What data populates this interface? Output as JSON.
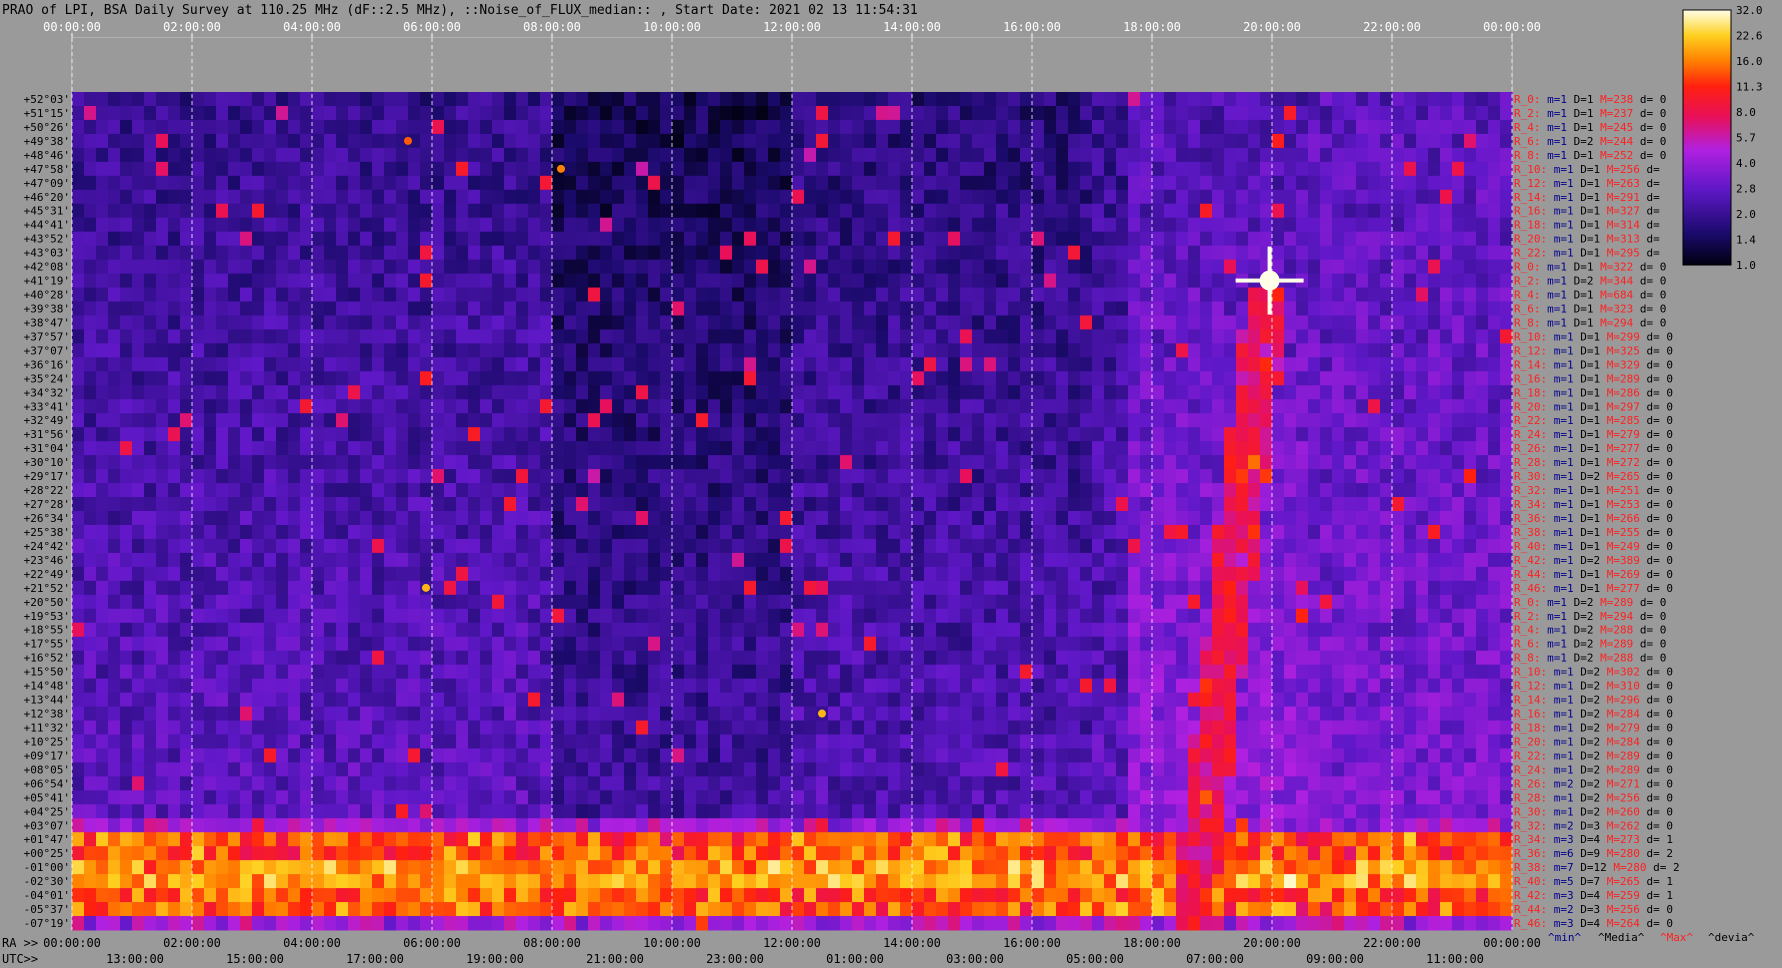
{
  "title": "PRAO of LPI, BSA Daily Survey at 110.25 MHz (dF::2.5 MHz), ::Noise_of_FLUX_median:: , Start Date: 2021 02 13 11:54:31",
  "colors": {
    "background": "#9a9a9a",
    "label_red": "#ff2020",
    "label_blue": "#00008b",
    "label_black": "#000000",
    "label_white": "#ffffff"
  },
  "chart_data": {
    "type": "heatmap",
    "colormap": "black-blue-purple-magenta-red-orange-yellow-white",
    "colorbar_ticks": [
      "32.0",
      "22.6",
      "16.0",
      "11.3",
      "8.0",
      "5.7",
      "4.0",
      "2.8",
      "2.0",
      "1.4",
      "1.0"
    ],
    "colorbar_range": [
      1.0,
      32.0
    ],
    "x_top_labels": [
      "00:00:00",
      "02:00:00",
      "04:00:00",
      "06:00:00",
      "08:00:00",
      "10:00:00",
      "12:00:00",
      "14:00:00",
      "16:00:00",
      "18:00:00",
      "20:00:00",
      "22:00:00",
      "00:00:00"
    ],
    "x_bottom_ra_prefix": "RA >>",
    "x_bottom_ra_labels": [
      "00:00:00",
      "02:00:00",
      "04:00:00",
      "06:00:00",
      "08:00:00",
      "10:00:00",
      "12:00:00",
      "14:00:00",
      "16:00:00",
      "18:00:00",
      "20:00:00",
      "22:00:00",
      "00:00:00"
    ],
    "x_bottom_utc_prefix": "UTC>>",
    "x_bottom_utc_labels": [
      "13:00:00",
      "15:00:00",
      "17:00:00",
      "19:00:00",
      "21:00:00",
      "23:00:00",
      "01:00:00",
      "03:00:00",
      "05:00:00",
      "07:00:00",
      "09:00:00",
      "11:00:00"
    ],
    "declinations": [
      "+52°03'",
      "+51°15'",
      "+50°26'",
      "+49°38'",
      "+48°46'",
      "+47°58'",
      "+47°09'",
      "+46°20'",
      "+45°31'",
      "+44°41'",
      "+43°52'",
      "+43°03'",
      "+42°08'",
      "+41°19'",
      "+40°28'",
      "+39°38'",
      "+38°47'",
      "+37°57'",
      "+37°07'",
      "+36°16'",
      "+35°24'",
      "+34°32'",
      "+33°41'",
      "+32°49'",
      "+31°56'",
      "+31°04'",
      "+30°10'",
      "+29°17'",
      "+28°22'",
      "+27°28'",
      "+26°34'",
      "+25°38'",
      "+24°42'",
      "+23°46'",
      "+22°49'",
      "+21°52'",
      "+20°50'",
      "+19°53'",
      "+18°55'",
      "+17°55'",
      "+16°52'",
      "+15°50'",
      "+14°48'",
      "+13°44'",
      "+12°38'",
      "+11°32'",
      "+10°25'",
      "+09°17'",
      "+08°05'",
      "+06°54'",
      "+05°41'",
      "+04°25'",
      "+03°07'",
      "+01°47'",
      "+00°25'",
      "-01°00'",
      "-02°30'",
      "-04°01'",
      "-05°37'",
      "-07°19'"
    ],
    "row_stats": [
      {
        "r": "R_0:",
        "m": "m=1",
        "D": "D=1",
        "M": "M=238",
        "d": "d= 0"
      },
      {
        "r": "R_2:",
        "m": "m=1",
        "D": "D=1",
        "M": "M=237",
        "d": "d= 0"
      },
      {
        "r": "R_4:",
        "m": "m=1",
        "D": "D=1",
        "M": "M=245",
        "d": "d= 0"
      },
      {
        "r": "R_6:",
        "m": "m=1",
        "D": "D=2",
        "M": "M=244",
        "d": "d= 0"
      },
      {
        "r": "R_8:",
        "m": "m=1",
        "D": "D=1",
        "M": "M=252",
        "d": "d= 0"
      },
      {
        "r": "R_10:",
        "m": "m=1",
        "D": "D=1",
        "M": "M=256",
        "d": "d="
      },
      {
        "r": "R_12:",
        "m": "m=1",
        "D": "D=1",
        "M": "M=263",
        "d": "d="
      },
      {
        "r": "R_14:",
        "m": "m=1",
        "D": "D=1",
        "M": "M=291",
        "d": "d="
      },
      {
        "r": "R_16:",
        "m": "m=1",
        "D": "D=1",
        "M": "M=327",
        "d": "d="
      },
      {
        "r": "R_18:",
        "m": "m=1",
        "D": "D=1",
        "M": "M=314",
        "d": "d="
      },
      {
        "r": "R_20:",
        "m": "m=1",
        "D": "D=1",
        "M": "M=313",
        "d": "d="
      },
      {
        "r": "R_22:",
        "m": "m=1",
        "D": "D=1",
        "M": "M=295",
        "d": "d="
      },
      {
        "r": "R_0:",
        "m": "m=1",
        "D": "D=1",
        "M": "M=322",
        "d": "d= 0"
      },
      {
        "r": "R_2:",
        "m": "m=1",
        "D": "D=2",
        "M": "M=344",
        "d": "d= 0"
      },
      {
        "r": "R_4:",
        "m": "m=1",
        "D": "D=1",
        "M": "M=684",
        "d": "d= 0"
      },
      {
        "r": "R_6:",
        "m": "m=1",
        "D": "D=1",
        "M": "M=323",
        "d": "d= 0"
      },
      {
        "r": "R_8:",
        "m": "m=1",
        "D": "D=1",
        "M": "M=294",
        "d": "d= 0"
      },
      {
        "r": "R_10:",
        "m": "m=1",
        "D": "D=1",
        "M": "M=299",
        "d": "d= 0"
      },
      {
        "r": "R_12:",
        "m": "m=1",
        "D": "D=1",
        "M": "M=325",
        "d": "d= 0"
      },
      {
        "r": "R_14:",
        "m": "m=1",
        "D": "D=1",
        "M": "M=329",
        "d": "d= 0"
      },
      {
        "r": "R_16:",
        "m": "m=1",
        "D": "D=1",
        "M": "M=289",
        "d": "d= 0"
      },
      {
        "r": "R_18:",
        "m": "m=1",
        "D": "D=1",
        "M": "M=286",
        "d": "d= 0"
      },
      {
        "r": "R_20:",
        "m": "m=1",
        "D": "D=1",
        "M": "M=297",
        "d": "d= 0"
      },
      {
        "r": "R_22:",
        "m": "m=1",
        "D": "D=1",
        "M": "M=285",
        "d": "d= 0"
      },
      {
        "r": "R_24:",
        "m": "m=1",
        "D": "D=1",
        "M": "M=279",
        "d": "d= 0"
      },
      {
        "r": "R_26:",
        "m": "m=1",
        "D": "D=1",
        "M": "M=277",
        "d": "d= 0"
      },
      {
        "r": "R_28:",
        "m": "m=1",
        "D": "D=1",
        "M": "M=272",
        "d": "d= 0"
      },
      {
        "r": "R_30:",
        "m": "m=1",
        "D": "D=2",
        "M": "M=265",
        "d": "d= 0"
      },
      {
        "r": "R_32:",
        "m": "m=1",
        "D": "D=1",
        "M": "M=251",
        "d": "d= 0"
      },
      {
        "r": "R_34:",
        "m": "m=1",
        "D": "D=1",
        "M": "M=253",
        "d": "d= 0"
      },
      {
        "r": "R_36:",
        "m": "m=1",
        "D": "D=1",
        "M": "M=266",
        "d": "d= 0"
      },
      {
        "r": "R_38:",
        "m": "m=1",
        "D": "D=1",
        "M": "M=255",
        "d": "d= 0"
      },
      {
        "r": "R_40:",
        "m": "m=1",
        "D": "D=1",
        "M": "M=249",
        "d": "d= 0"
      },
      {
        "r": "R_42:",
        "m": "m=1",
        "D": "D=2",
        "M": "M=389",
        "d": "d= 0"
      },
      {
        "r": "R_44:",
        "m": "m=1",
        "D": "D=1",
        "M": "M=269",
        "d": "d= 0"
      },
      {
        "r": "R_46:",
        "m": "m=1",
        "D": "D=1",
        "M": "M=277",
        "d": "d= 0"
      },
      {
        "r": "R_0:",
        "m": "m=1",
        "D": "D=2",
        "M": "M=289",
        "d": "d= 0"
      },
      {
        "r": "R_2:",
        "m": "m=1",
        "D": "D=2",
        "M": "M=294",
        "d": "d= 0"
      },
      {
        "r": "R_4:",
        "m": "m=1",
        "D": "D=2",
        "M": "M=288",
        "d": "d= 0"
      },
      {
        "r": "R_6:",
        "m": "m=1",
        "D": "D=2",
        "M": "M=289",
        "d": "d= 0"
      },
      {
        "r": "R_8:",
        "m": "m=1",
        "D": "D=2",
        "M": "M=288",
        "d": "d= 0"
      },
      {
        "r": "R_10:",
        "m": "m=1",
        "D": "D=2",
        "M": "M=302",
        "d": "d= 0"
      },
      {
        "r": "R_12:",
        "m": "m=1",
        "D": "D=2",
        "M": "M=310",
        "d": "d= 0"
      },
      {
        "r": "R_14:",
        "m": "m=1",
        "D": "D=2",
        "M": "M=296",
        "d": "d= 0"
      },
      {
        "r": "R_16:",
        "m": "m=1",
        "D": "D=2",
        "M": "M=284",
        "d": "d= 0"
      },
      {
        "r": "R_18:",
        "m": "m=1",
        "D": "D=2",
        "M": "M=279",
        "d": "d= 0"
      },
      {
        "r": "R_20:",
        "m": "m=1",
        "D": "D=2",
        "M": "M=284",
        "d": "d= 0"
      },
      {
        "r": "R_22:",
        "m": "m=1",
        "D": "D=2",
        "M": "M=289",
        "d": "d= 0"
      },
      {
        "r": "R_24:",
        "m": "m=1",
        "D": "D=2",
        "M": "M=289",
        "d": "d= 0"
      },
      {
        "r": "R_26:",
        "m": "m=2",
        "D": "D=2",
        "M": "M=271",
        "d": "d= 0"
      },
      {
        "r": "R_28:",
        "m": "m=1",
        "D": "D=2",
        "M": "M=256",
        "d": "d= 0"
      },
      {
        "r": "R_30:",
        "m": "m=1",
        "D": "D=2",
        "M": "M=260",
        "d": "d= 0"
      },
      {
        "r": "R_32:",
        "m": "m=2",
        "D": "D=3",
        "M": "M=262",
        "d": "d= 0"
      },
      {
        "r": "R_34:",
        "m": "m=3",
        "D": "D=4",
        "M": "M=273",
        "d": "d= 1"
      },
      {
        "r": "R_36:",
        "m": "m=6",
        "D": "D=9",
        "M": "M=280",
        "d": "d= 2"
      },
      {
        "r": "R_38:",
        "m": "m=7",
        "D": "D=12",
        "M": "M=280",
        "d": "d= 2"
      },
      {
        "r": "R_40:",
        "m": "m=5",
        "D": "D=7",
        "M": "M=265",
        "d": "d= 1"
      },
      {
        "r": "R_42:",
        "m": "m=3",
        "D": "D=4",
        "M": "M=259",
        "d": "d= 1"
      },
      {
        "r": "R_44:",
        "m": "m=2",
        "D": "D=3",
        "M": "M=256",
        "d": "d= 0"
      },
      {
        "r": "R_46:",
        "m": "m=3",
        "D": "D=4",
        "M": "M=264",
        "d": "d= 0"
      }
    ],
    "stats_legend": [
      "^min^",
      "^Media^",
      "^Max^",
      "^devia^"
    ],
    "bright_sources": [
      {
        "name_shown": "",
        "ra_hours": 19.96,
        "dec_row": 13,
        "intensity": 32
      },
      {
        "ra_hours": 12.5,
        "dec_row": 44,
        "intensity": 20
      },
      {
        "ra_hours": 5.9,
        "dec_row": 35,
        "intensity": 20
      },
      {
        "ra_hours": 5.6,
        "dec_row": 3,
        "intensity": 14
      },
      {
        "ra_hours": 8.15,
        "dec_row": 5,
        "intensity": 16
      }
    ]
  }
}
